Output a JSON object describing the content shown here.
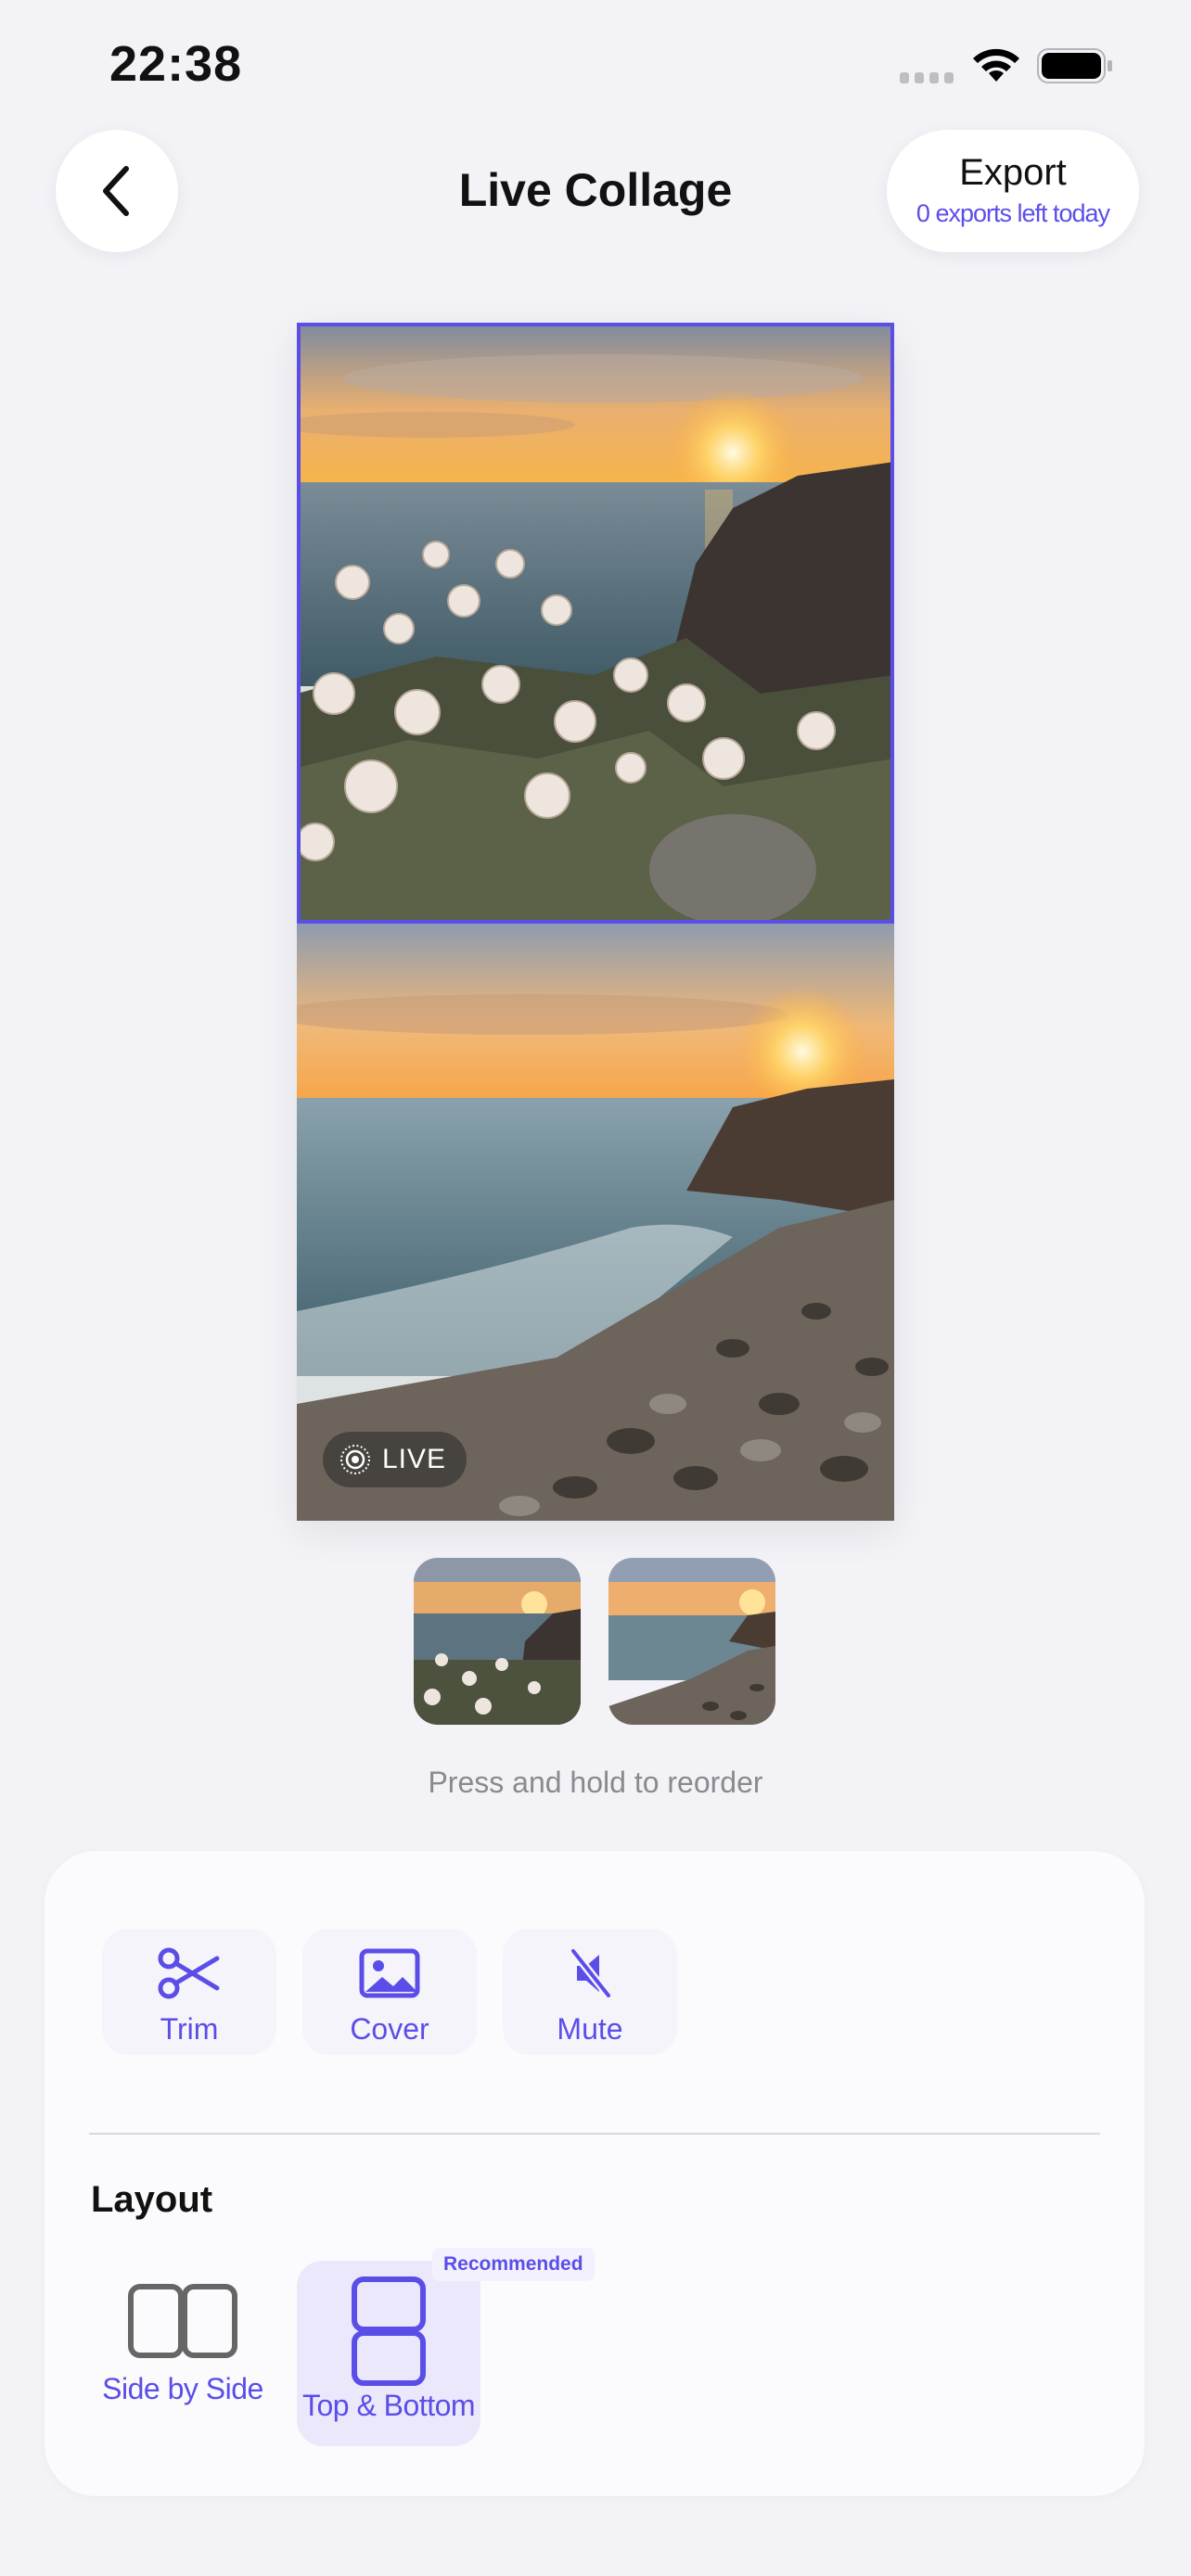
{
  "status_bar": {
    "time": "22:38"
  },
  "header": {
    "title": "Live Collage",
    "export_label": "Export",
    "export_subtitle": "0 exports left today"
  },
  "collage": {
    "live_badge": "LIVE",
    "layout": "top-bottom",
    "selected_panel": "top"
  },
  "reorder_hint": "Press and hold to reorder",
  "tools": [
    {
      "label": "Trim",
      "icon": "scissors-icon"
    },
    {
      "label": "Cover",
      "icon": "image-icon"
    },
    {
      "label": "Mute",
      "icon": "speaker-muted-icon"
    }
  ],
  "layout_section": {
    "title": "Layout",
    "options": [
      {
        "label": "Side by Side",
        "icon": "side-by-side-icon",
        "selected": false
      },
      {
        "label": "Top & Bottom",
        "icon": "top-bottom-icon",
        "selected": true,
        "badge": "Recommended"
      }
    ]
  },
  "colors": {
    "accent": "#5b4ee8",
    "background": "#f2f2f7",
    "card": "#fbfbfd"
  }
}
